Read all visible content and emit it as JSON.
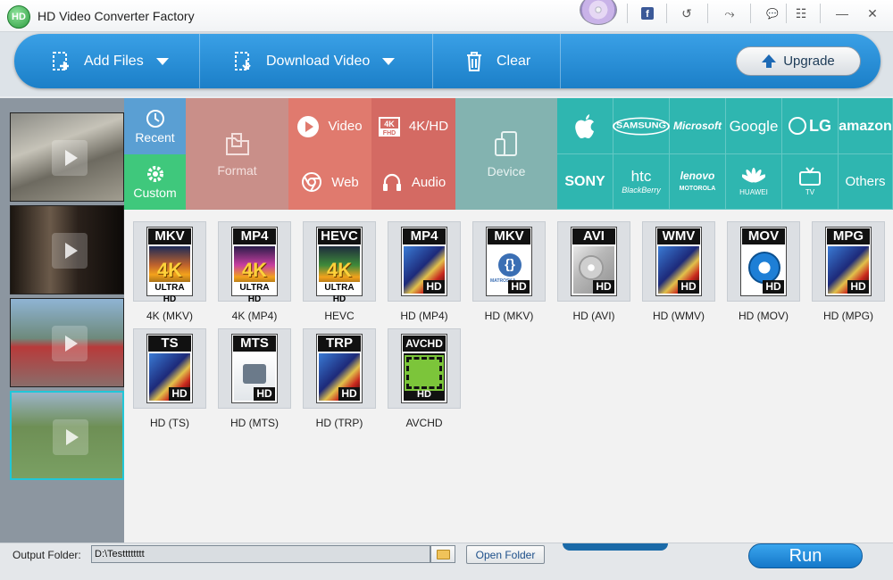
{
  "window": {
    "title": "HD Video Converter Factory",
    "app_icon_text": "HD"
  },
  "title_buttons": {
    "facebook": "f",
    "undo": "↺",
    "tool": "⤳",
    "chat": "💬",
    "list": "☷",
    "minimize": "—",
    "close": "✕"
  },
  "toolbar": {
    "add_files": "Add Files",
    "download_video": "Download Video",
    "clear": "Clear",
    "upgrade": "Upgrade"
  },
  "categories": {
    "recent": "Recent",
    "custom": "Custom",
    "format": "Format",
    "video": "Video",
    "hd": "4K/HD",
    "web": "Web",
    "audio": "Audio",
    "device": "Device"
  },
  "brands": {
    "apple": "",
    "samsung": "SAMSUNG",
    "microsoft": "Microsoft",
    "google": "Google",
    "lg": "LG",
    "amazon": "amazon",
    "sony": "SONY",
    "htc": "htc",
    "htc_sub": "BlackBerry",
    "lenovo": "lenovo",
    "lenovo_sub": "MOTOROLA",
    "huawei": "HUAWEI",
    "tv": "TV",
    "others": "Others"
  },
  "formats": [
    {
      "label": "4K (MKV)",
      "badge": "MKV"
    },
    {
      "label": "4K (MP4)",
      "badge": "MP4"
    },
    {
      "label": "HEVC",
      "badge": "HEVC"
    },
    {
      "label": "HD (MP4)",
      "badge": "MP4"
    },
    {
      "label": "HD (MKV)",
      "badge": "MKV"
    },
    {
      "label": "HD (AVI)",
      "badge": "AVI"
    },
    {
      "label": "HD (WMV)",
      "badge": "WMV"
    },
    {
      "label": "HD (MOV)",
      "badge": "MOV"
    },
    {
      "label": "HD (MPG)",
      "badge": "MPG"
    },
    {
      "label": "HD (TS)",
      "badge": "TS"
    },
    {
      "label": "HD (MTS)",
      "badge": "MTS"
    },
    {
      "label": "HD (TRP)",
      "badge": "TRP"
    },
    {
      "label": "AVCHD",
      "badge": "AVCHD"
    }
  ],
  "art_text": {
    "k4": "4K",
    "uhd": "ULTRA HD",
    "hd": "HD",
    "brace": "{}",
    "matroska": "MATROSKA",
    "fourk_tag": "4K",
    "fhd_tag": "FHD"
  },
  "bottom": {
    "output_label": "Output Folder:",
    "output_value": "D:\\Testttttttt",
    "open_folder": "Open Folder",
    "run": "Run"
  },
  "colors": {
    "accent": "#1b7fc8",
    "recent": "#5a9fd3",
    "custom": "#3fc87c",
    "format": "#c98f89",
    "video": "#e07a6e",
    "device": "#83b3b0",
    "brand": "#2fb6b0"
  }
}
